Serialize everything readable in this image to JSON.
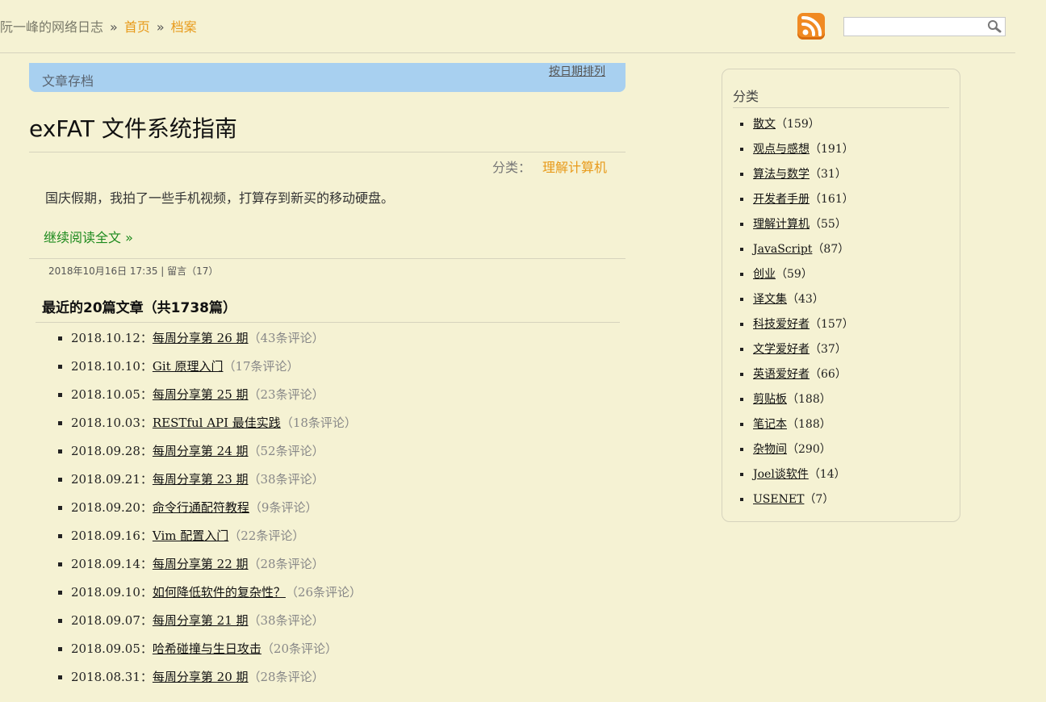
{
  "header": {
    "blog_name": "阮一峰的网络日志",
    "separator": "»",
    "home": "首页",
    "archive": "档案",
    "search_placeholder": "",
    "rss_icon": "rss-icon",
    "search_icon": "magnifier-icon"
  },
  "archive_bar": {
    "title": "文章存档",
    "sort_link": "按日期排列"
  },
  "post": {
    "title": "exFAT 文件系统指南",
    "category_label": "分类：",
    "category": "理解计算机",
    "excerpt": "国庆假期，我拍了一些手机视频，打算存到新买的移动硬盘。",
    "read_more": "继续阅读全文 »",
    "meta": "2018年10月16日 17:35 | 留言（17）"
  },
  "recent": {
    "title": "最近的20篇文章（共1738篇）",
    "items": [
      {
        "date": "2018.10.12：",
        "title": "每周分享第 26 期",
        "count": "（43条评论）"
      },
      {
        "date": "2018.10.10：",
        "title": "Git 原理入门",
        "count": "（17条评论）"
      },
      {
        "date": "2018.10.05：",
        "title": "每周分享第 25 期",
        "count": "（23条评论）"
      },
      {
        "date": "2018.10.03：",
        "title": "RESTful API 最佳实践",
        "count": "（18条评论）"
      },
      {
        "date": "2018.09.28：",
        "title": "每周分享第 24 期",
        "count": "（52条评论）"
      },
      {
        "date": "2018.09.21：",
        "title": "每周分享第 23 期",
        "count": "（38条评论）"
      },
      {
        "date": "2018.09.20：",
        "title": "命令行通配符教程",
        "count": "（9条评论）"
      },
      {
        "date": "2018.09.16：",
        "title": "Vim 配置入门",
        "count": "（22条评论）"
      },
      {
        "date": "2018.09.14：",
        "title": "每周分享第 22 期",
        "count": "（28条评论）"
      },
      {
        "date": "2018.09.10：",
        "title": "如何降低软件的复杂性？",
        "count": "（26条评论）"
      },
      {
        "date": "2018.09.07：",
        "title": "每周分享第 21 期",
        "count": "（38条评论）"
      },
      {
        "date": "2018.09.05：",
        "title": "哈希碰撞与生日攻击",
        "count": "（20条评论）"
      },
      {
        "date": "2018.08.31：",
        "title": "每周分享第 20 期",
        "count": "（28条评论）"
      }
    ]
  },
  "sidebar": {
    "title": "分类",
    "categories": [
      {
        "name": "散文",
        "count": "（159）"
      },
      {
        "name": "观点与感想",
        "count": "（191）"
      },
      {
        "name": "算法与数学",
        "count": "（31）"
      },
      {
        "name": "开发者手册",
        "count": "（161）"
      },
      {
        "name": "理解计算机",
        "count": "（55）"
      },
      {
        "name": "JavaScript",
        "count": "（87）"
      },
      {
        "name": "创业",
        "count": "（59）"
      },
      {
        "name": "译文集",
        "count": "（43）"
      },
      {
        "name": "科技爱好者",
        "count": "（157）"
      },
      {
        "name": "文学爱好者",
        "count": "（37）"
      },
      {
        "name": "英语爱好者",
        "count": "（66）"
      },
      {
        "name": "剪贴板",
        "count": "（188）"
      },
      {
        "name": "笔记本",
        "count": "（188）"
      },
      {
        "name": "杂物间",
        "count": "（290）"
      },
      {
        "name": "Joel谈软件",
        "count": "（14）"
      },
      {
        "name": "USENET",
        "count": "（7）"
      }
    ]
  }
}
